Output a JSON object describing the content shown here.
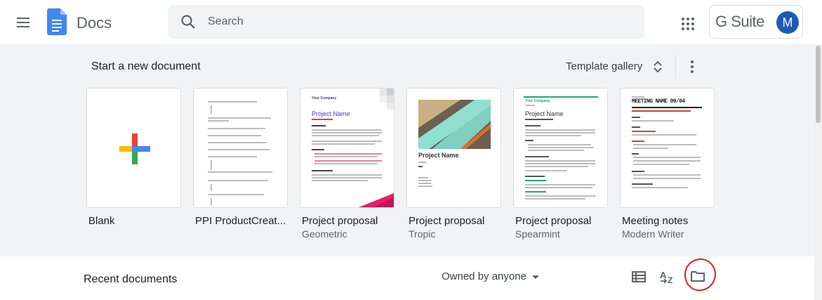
{
  "header": {
    "app_name": "Docs",
    "search_placeholder": "Search",
    "brand": "G Suite",
    "avatar_initial": "M",
    "avatar_color": "#1a5ab8"
  },
  "templates": {
    "section_title": "Start a new document",
    "gallery_label": "Template gallery",
    "items": [
      {
        "name": "Blank",
        "subtitle": ""
      },
      {
        "name": "PPI ProductCreat...",
        "subtitle": ""
      },
      {
        "name": "Project proposal",
        "subtitle": "Geometric",
        "thumb_company": "Your Company",
        "thumb_title": "Project Name"
      },
      {
        "name": "Project proposal",
        "subtitle": "Tropic",
        "thumb_title": "Project Name"
      },
      {
        "name": "Project proposal",
        "subtitle": "Spearmint",
        "thumb_company": "Your Company",
        "thumb_title": "Project Name"
      },
      {
        "name": "Meeting notes",
        "subtitle": "Modern Writer",
        "thumb_title": "MEETING NAME 09/04"
      }
    ]
  },
  "recent": {
    "title": "Recent documents",
    "owner_filter": "Owned by anyone"
  },
  "colors": {
    "section_bg": "#f1f3f4",
    "annotation": "#e0201b"
  }
}
